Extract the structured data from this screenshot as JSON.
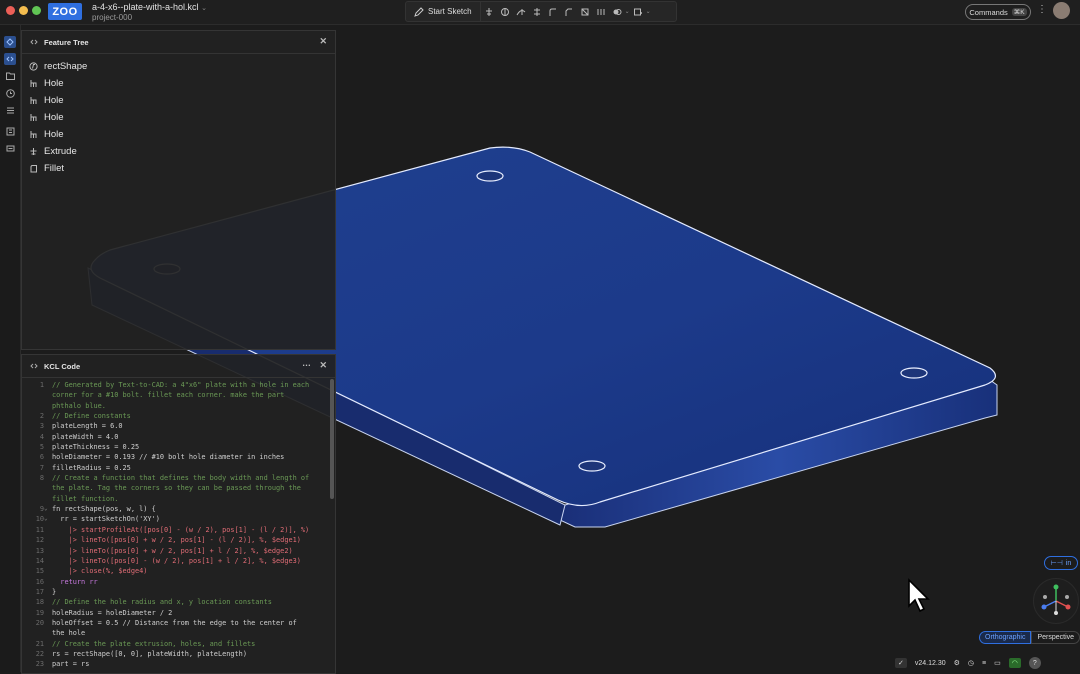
{
  "app": {
    "logo": "ZOO",
    "filename": "a-4-x6--plate-with-a-hol.kcl",
    "project": "project-000"
  },
  "toolbar": {
    "start_sketch": "Start Sketch"
  },
  "commands": {
    "label": "Commands",
    "shortcut": "⌘K"
  },
  "feature_tree": {
    "title": "Feature Tree",
    "items": [
      {
        "label": "rectShape",
        "icon": "function-icon"
      },
      {
        "label": "Hole",
        "icon": "hole-icon"
      },
      {
        "label": "Hole",
        "icon": "hole-icon"
      },
      {
        "label": "Hole",
        "icon": "hole-icon"
      },
      {
        "label": "Hole",
        "icon": "hole-icon"
      },
      {
        "label": "Extrude",
        "icon": "extrude-icon"
      },
      {
        "label": "Fillet",
        "icon": "fillet-icon"
      }
    ]
  },
  "kcl": {
    "title": "KCL Code",
    "lines": [
      {
        "n": "1",
        "t": "// Generated by Text-to-CAD: a 4\"x6\" plate with a hole in each"
      },
      {
        "n": "",
        "t": "corner for a #10 bolt. fillet each corner. make the part"
      },
      {
        "n": "",
        "t": "phthalo blue."
      },
      {
        "n": "2",
        "t": "// Define constants"
      },
      {
        "n": "3",
        "t": "plateLength = 6.0"
      },
      {
        "n": "4",
        "t": "plateWidth = 4.0"
      },
      {
        "n": "5",
        "t": "plateThickness = 0.25"
      },
      {
        "n": "6",
        "t": "holeDiameter = 0.193 // #10 bolt hole diameter in inches"
      },
      {
        "n": "7",
        "t": "filletRadius = 0.25"
      },
      {
        "n": "8",
        "t": "// Create a function that defines the body width and length of"
      },
      {
        "n": "",
        "t": "the plate. Tag the corners so they can be passed through the"
      },
      {
        "n": "",
        "t": "fillet function."
      },
      {
        "n": "9",
        "t": "fn rectShape(pos, w, l) {"
      },
      {
        "n": "10",
        "t": "  rr = startSketchOn('XY')"
      },
      {
        "n": "11",
        "t": "    |> startProfileAt([pos[0] - (w / 2), pos[1] - (l / 2)], %)"
      },
      {
        "n": "12",
        "t": "    |> lineTo([pos[0] + w / 2, pos[1] - (l / 2)], %, $edge1)"
      },
      {
        "n": "13",
        "t": "    |> lineTo([pos[0] + w / 2, pos[1] + l / 2], %, $edge2)"
      },
      {
        "n": "14",
        "t": "    |> lineTo([pos[0] - (w / 2), pos[1] + l / 2], %, $edge3)"
      },
      {
        "n": "15",
        "t": "    |> close(%, $edge4)"
      },
      {
        "n": "16",
        "t": "  return rr"
      },
      {
        "n": "17",
        "t": "}"
      },
      {
        "n": "18",
        "t": "// Define the hole radius and x, y location constants"
      },
      {
        "n": "19",
        "t": "holeRadius = holeDiameter / 2"
      },
      {
        "n": "20",
        "t": "holeOffset = 0.5 // Distance from the edge to the center of"
      },
      {
        "n": "",
        "t": "the hole"
      },
      {
        "n": "21",
        "t": "// Create the plate extrusion, holes, and fillets"
      },
      {
        "n": "22",
        "t": "rs = rectShape([0, 0], plateWidth, plateLength)"
      },
      {
        "n": "23",
        "t": "part = rs"
      }
    ]
  },
  "view": {
    "units": "in",
    "ortho": "Orthographic",
    "perspective": "Perspective",
    "version": "v24.12.30"
  },
  "colors": {
    "accent": "#2f6fe0",
    "plate_top": "#1f3a8a",
    "plate_side": "#1a2f7a"
  }
}
